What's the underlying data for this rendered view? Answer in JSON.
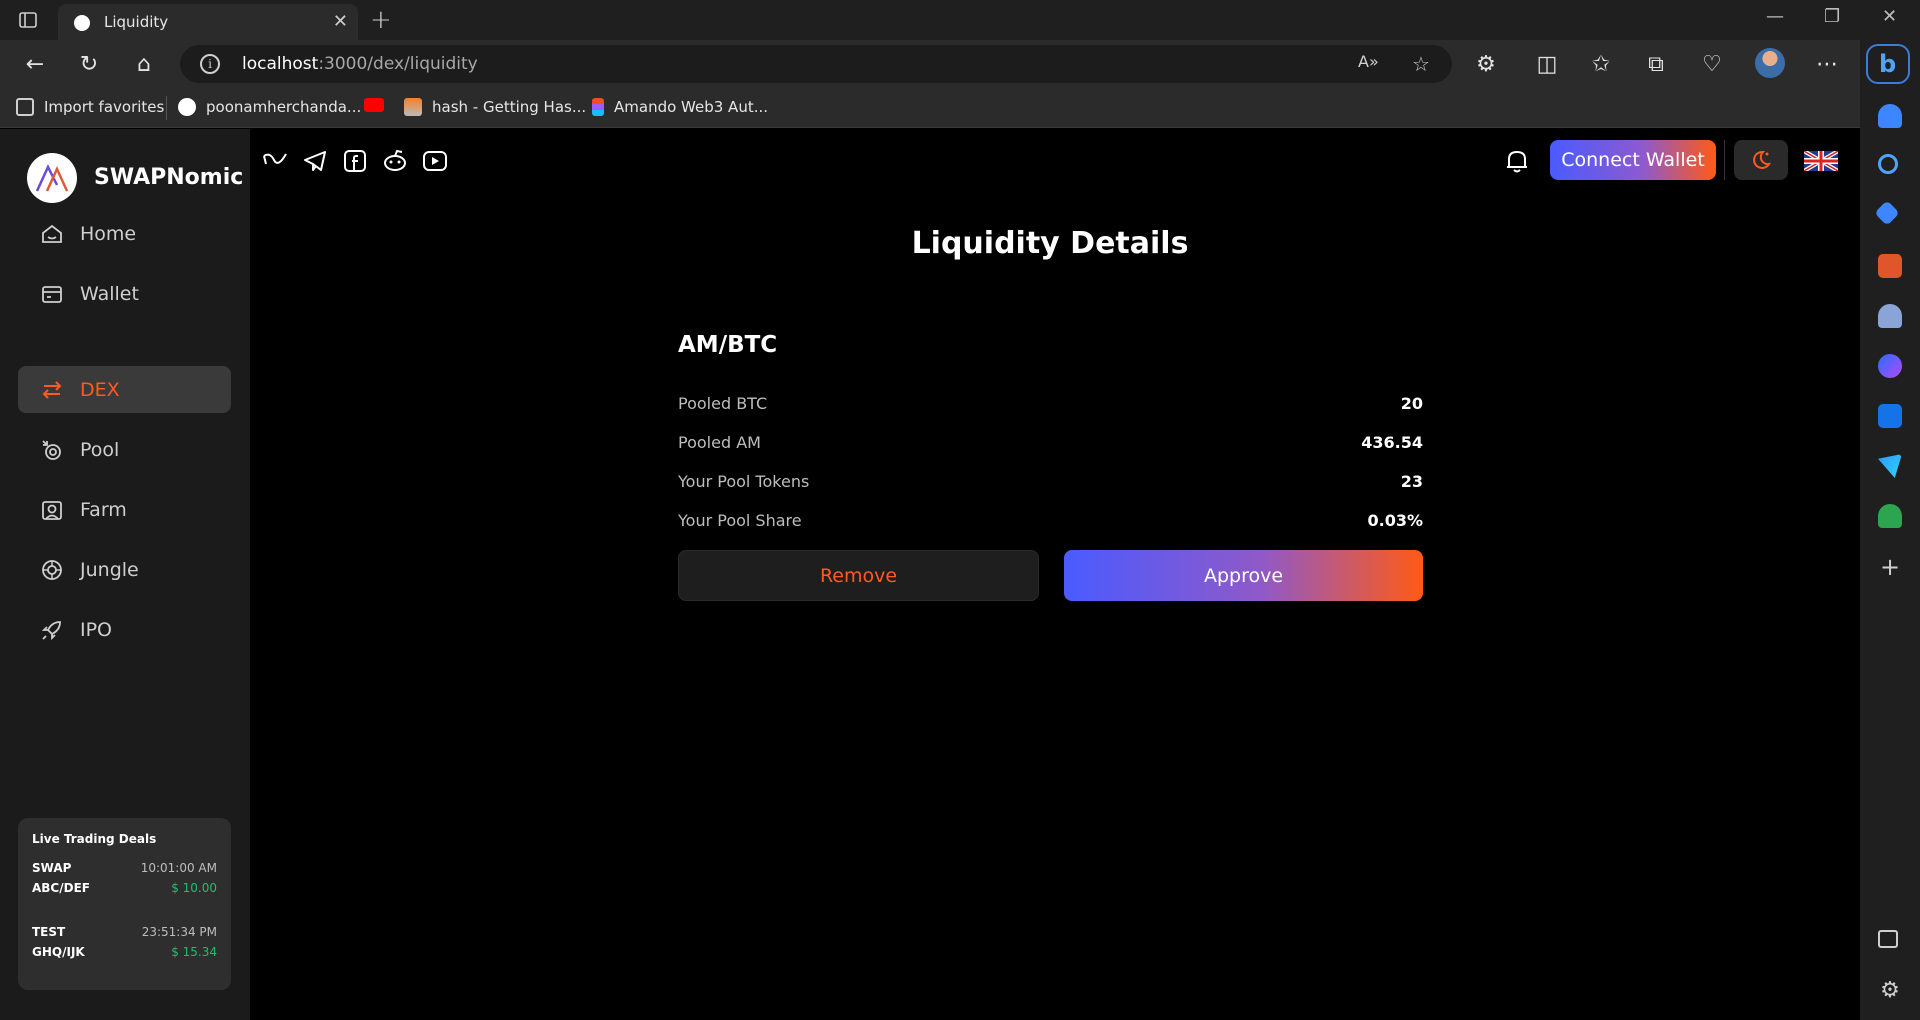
{
  "browser": {
    "tab_title": "Liquidity",
    "url_host": "localhost",
    "url_path": ":3000/dex/liquidity",
    "bookmarks": [
      {
        "label": "Import favorites",
        "icon": "import-icon"
      },
      {
        "label": "poonamherchanda...",
        "icon": "github-icon"
      },
      {
        "label": "",
        "icon": "youtube-icon"
      },
      {
        "label": "hash - Getting Has...",
        "icon": "stackoverflow-icon"
      },
      {
        "label": "Amando Web3 Aut...",
        "icon": "figma-icon"
      }
    ]
  },
  "sidebar": {
    "brand": "SWAPNomic",
    "items": [
      {
        "label": "Home",
        "icon": "home-icon"
      },
      {
        "label": "Wallet",
        "icon": "wallet-icon"
      },
      {
        "label": "DEX",
        "icon": "swap-arrows-icon"
      },
      {
        "label": "Pool",
        "icon": "pool-icon"
      },
      {
        "label": "Farm",
        "icon": "farm-icon"
      },
      {
        "label": "Jungle",
        "icon": "jungle-icon"
      },
      {
        "label": "IPO",
        "icon": "rocket-icon"
      }
    ],
    "active_item": "DEX",
    "deals": {
      "title": "Live Trading Deals",
      "items": [
        {
          "name": "SWAP",
          "time": "10:01:00 AM",
          "pair": "ABC/DEF",
          "price": "$ 10.00"
        },
        {
          "name": "TEST",
          "time": "23:51:34 PM",
          "pair": "GHQ/IJK",
          "price": "$ 15.34"
        }
      ]
    }
  },
  "header": {
    "socials": [
      "gitbook-icon",
      "telegram-icon",
      "facebook-icon",
      "reddit-icon",
      "youtube-icon"
    ],
    "connect_label": "Connect Wallet"
  },
  "main": {
    "title": "Liquidity Details",
    "pair": "AM/BTC",
    "rows": [
      {
        "label": "Pooled BTC",
        "value": "20"
      },
      {
        "label": "Pooled AM",
        "value": "436.54"
      },
      {
        "label": "Your Pool Tokens",
        "value": "23"
      },
      {
        "label": "Your Pool Share",
        "value": "0.03%"
      }
    ],
    "remove_label": "Remove",
    "approve_label": "Approve"
  },
  "colors": {
    "accent": "#ff5a1f",
    "gradient_start": "#4a5bff",
    "gradient_end": "#ff5a14",
    "positive": "#1fbf6a"
  }
}
